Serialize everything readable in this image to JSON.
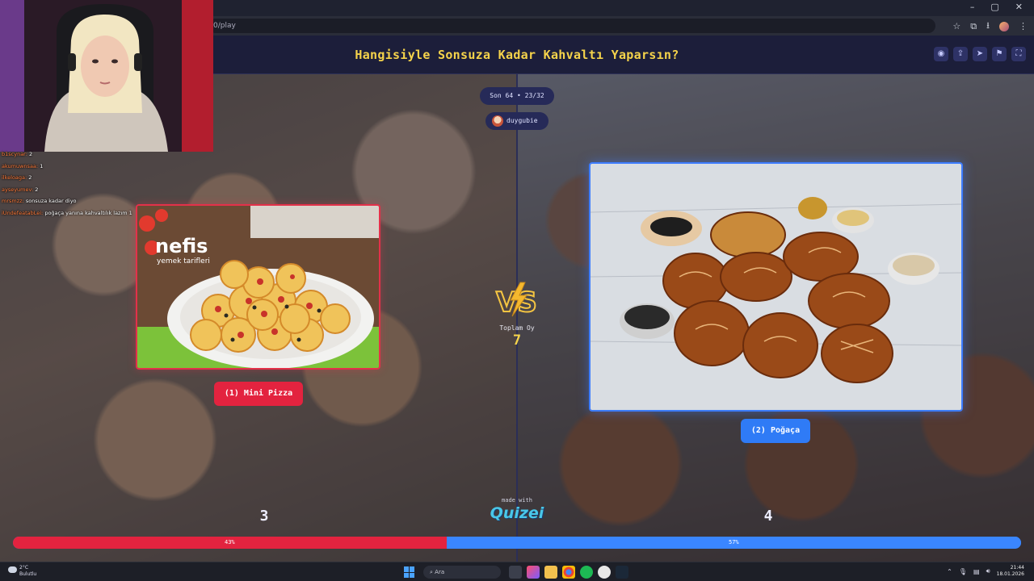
{
  "browser": {
    "address": "0/play",
    "window_controls": [
      "–",
      "▢",
      "✕"
    ]
  },
  "quiz": {
    "title": "Hangisiyle Sonsuza Kadar Kahvaltı Yaparsın?",
    "round": "Son 64 • 23/32",
    "username": "duygubie",
    "total_votes_label": "Toplam Oy",
    "total_votes": "7",
    "made_with": "made with",
    "brand": "Quizei"
  },
  "choices": [
    {
      "label": "(1) Mini Pizza",
      "votes": "3",
      "percent_label": "43%",
      "percent": 43
    },
    {
      "label": "(2) Poğaça",
      "votes": "4",
      "percent_label": "57%",
      "percent": 57
    }
  ],
  "image_watermark": {
    "brand": "nefis",
    "subtitle": "yemek tarifleri"
  },
  "chat": [
    {
      "user": "b1scynar:",
      "msg": "2"
    },
    {
      "user": "akumuwnsaa:",
      "msg": "1"
    },
    {
      "user": "ilkeloaga:",
      "msg": "2"
    },
    {
      "user": "ayseyumev:",
      "msg": "2"
    },
    {
      "user": "mrsmzz:",
      "msg": "sonsuza kadar diyo"
    },
    {
      "user": "iUndefeatabLei:",
      "msg": "poğaça yanına kahvaltılık lazım 1"
    }
  ],
  "taskbar": {
    "temperature": "2°C",
    "weather_text": "Bulutlu",
    "search_placeholder": "Ara",
    "time": "21:44",
    "date": "18.01.2026"
  },
  "colors": {
    "accent_yellow": "#f5d34b",
    "left_red": "#e3233f",
    "right_blue": "#2f7bf6",
    "header_bg": "#1c1e3a"
  }
}
